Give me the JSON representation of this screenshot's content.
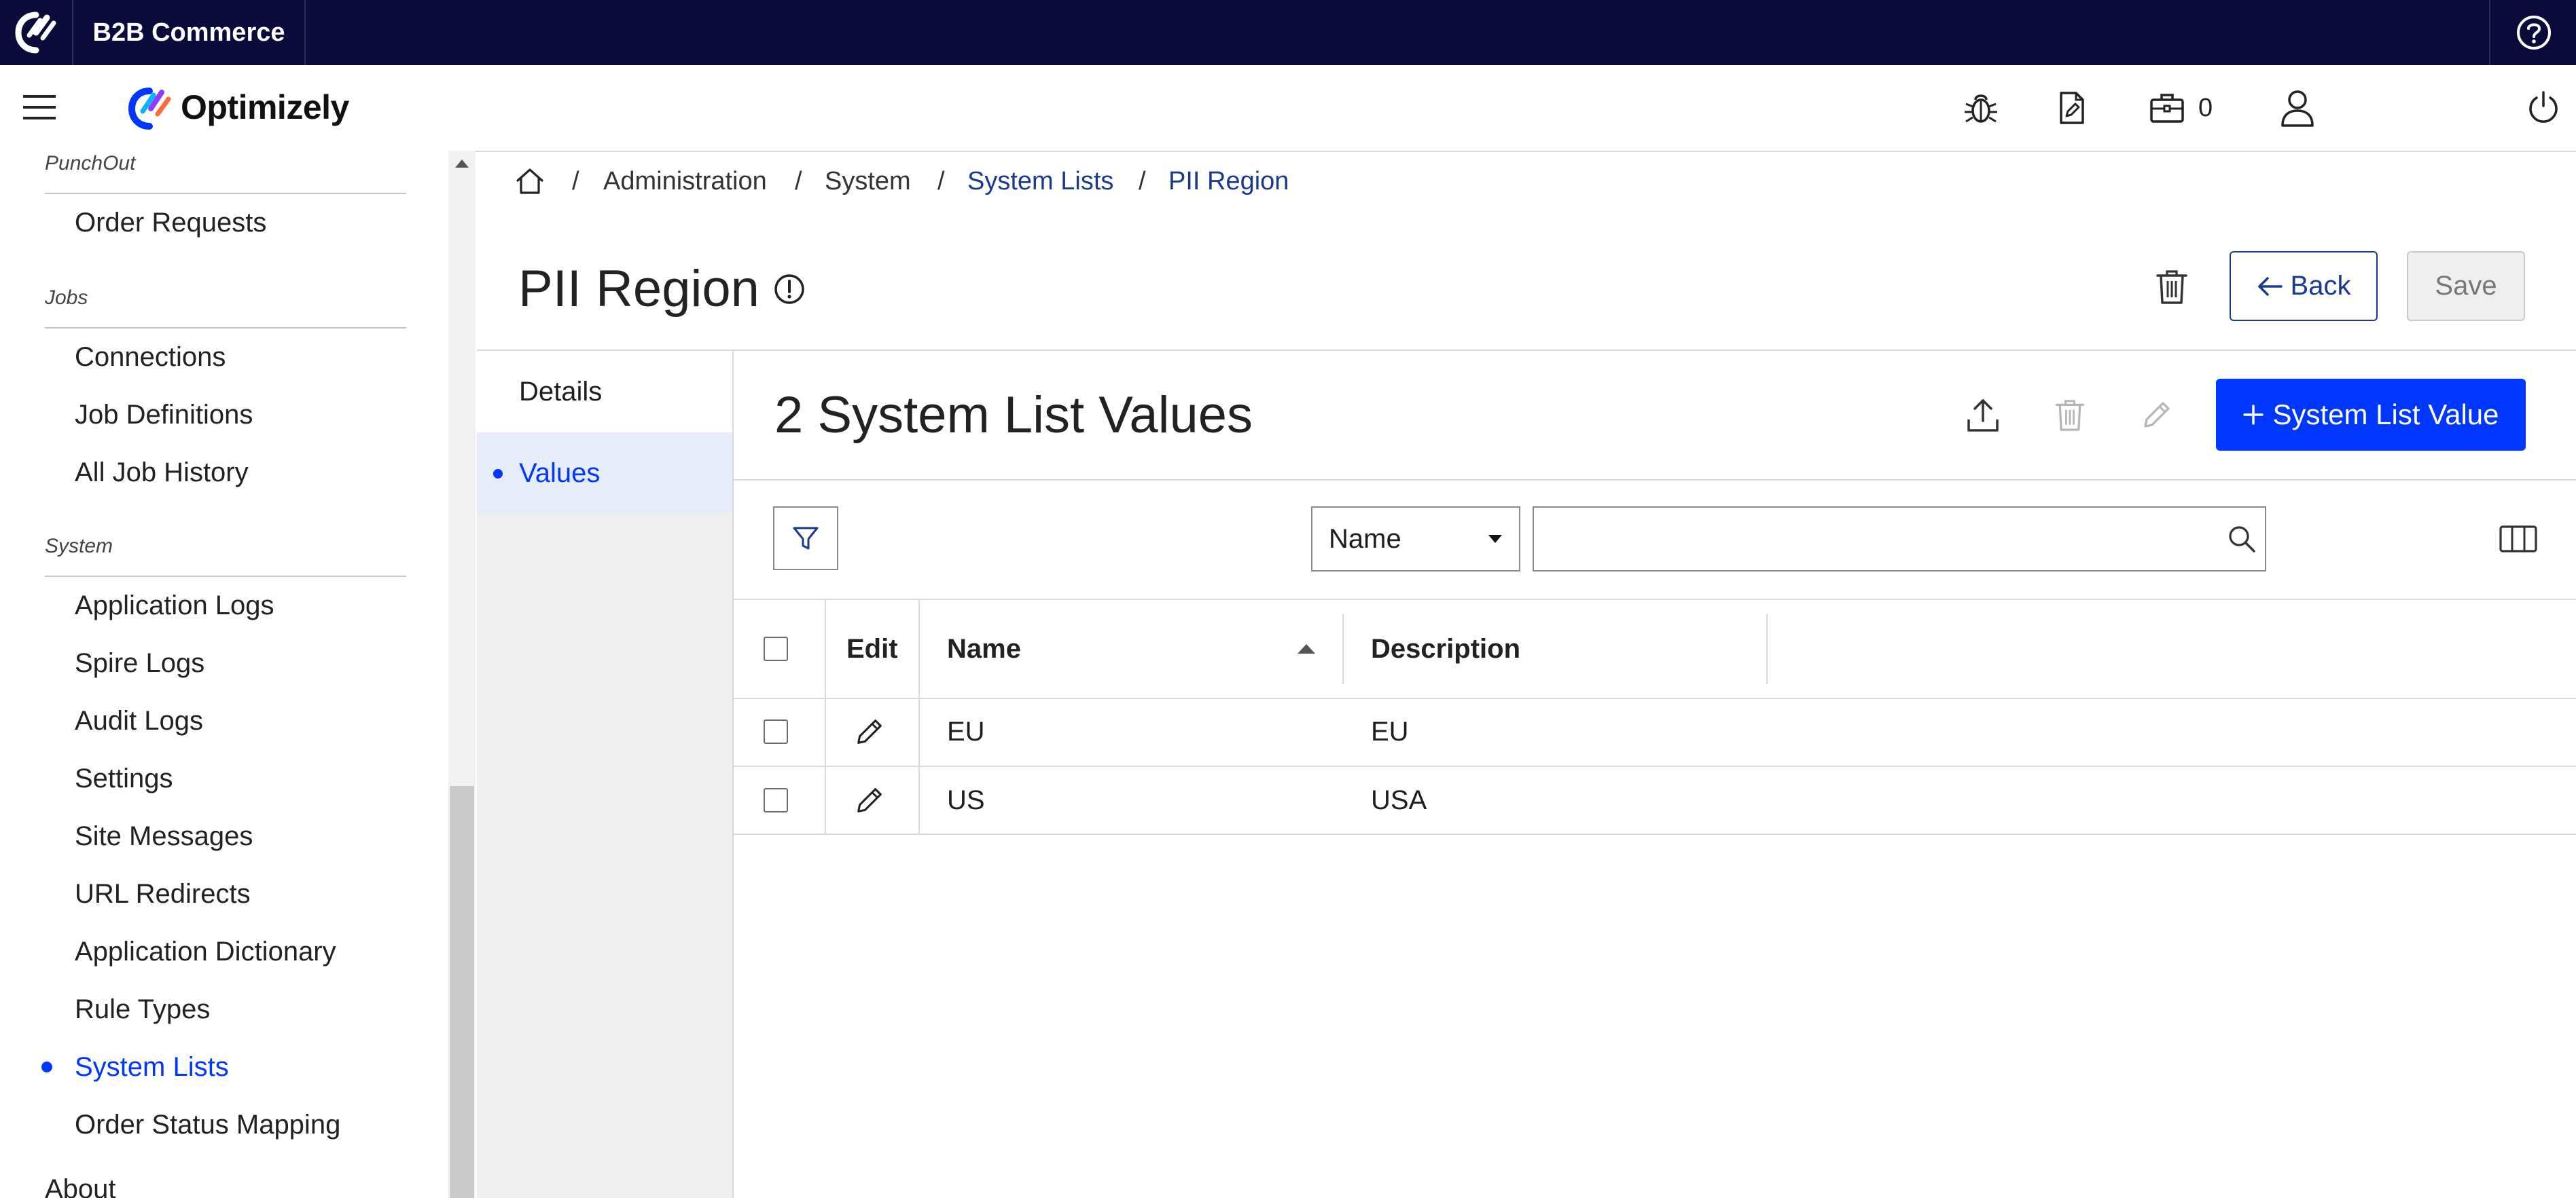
{
  "app": {
    "product_title": "B2B Commerce",
    "brand_name": "Optimizely",
    "cart_count": "0"
  },
  "colors": {
    "topbar": "#0b0b3b",
    "accent": "#0037ff",
    "link": "#1b3a8f"
  },
  "sidebar": {
    "sections": [
      {
        "title": "PunchOut",
        "items": [
          "Order Requests"
        ]
      },
      {
        "title": "Jobs",
        "items": [
          "Connections",
          "Job Definitions",
          "All Job History"
        ]
      },
      {
        "title": "System",
        "items": [
          "Application Logs",
          "Spire Logs",
          "Audit Logs",
          "Settings",
          "Site Messages",
          "URL Redirects",
          "Application Dictionary",
          "Rule Types",
          "System Lists",
          "Order Status Mapping"
        ]
      },
      {
        "title": "About",
        "items": []
      }
    ],
    "active_item": "System Lists"
  },
  "breadcrumb": {
    "items": [
      "Administration",
      "System",
      "System Lists",
      "PII Region"
    ]
  },
  "page": {
    "title": "PII Region",
    "back_label": "Back",
    "save_label": "Save"
  },
  "tabs": [
    {
      "label": "Details",
      "active": false
    },
    {
      "label": "Values",
      "active": true
    }
  ],
  "values_panel": {
    "title": "2 System List Values",
    "add_label": "System List Value",
    "filter_field": "Name",
    "search_value": ""
  },
  "table": {
    "columns": [
      "Edit",
      "Name",
      "Description"
    ],
    "sorted_column": "Name",
    "sort_direction": "ascending",
    "rows": [
      {
        "name": "EU",
        "description": "EU"
      },
      {
        "name": "US",
        "description": "USA"
      }
    ]
  }
}
